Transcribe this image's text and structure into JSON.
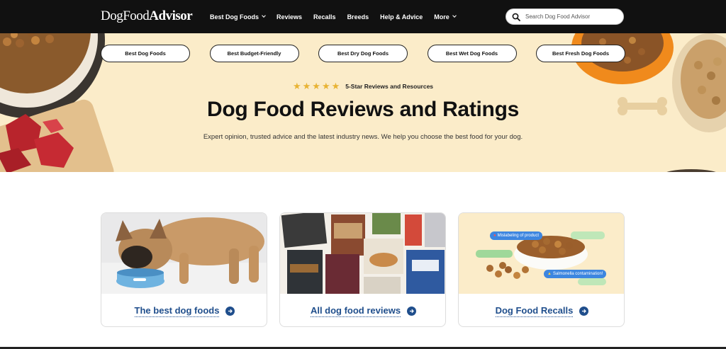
{
  "brand": {
    "logo_regular": "DogFood",
    "logo_bold": "Advisor"
  },
  "nav": [
    {
      "label": "Best Dog Foods",
      "has_dropdown": true
    },
    {
      "label": "Reviews",
      "has_dropdown": false
    },
    {
      "label": "Recalls",
      "has_dropdown": false
    },
    {
      "label": "Breeds",
      "has_dropdown": false
    },
    {
      "label": "Help & Advice",
      "has_dropdown": false
    },
    {
      "label": "More",
      "has_dropdown": true
    }
  ],
  "search": {
    "placeholder": "Search Dog Food Advisor",
    "value": ""
  },
  "hero": {
    "pills": [
      "Best Dog Foods",
      "Best Budget-Friendly",
      "Best Dry Dog Foods",
      "Best Wet Dog Foods",
      "Best Fresh Dog Foods"
    ],
    "rating_stars": 5,
    "rating_text": "5-Star Reviews and Resources",
    "title": "Dog Food Reviews and Ratings",
    "subtitle": "Expert opinion, trusted advice and the latest industry news. We help you choose the best food for your dog."
  },
  "cards": [
    {
      "label": "The best dog foods",
      "image": "dog-eating-from-bowl"
    },
    {
      "label": "All dog food reviews",
      "image": "dog-food-packages-collage"
    },
    {
      "label": "Dog Food Recalls",
      "image": "recall-alert-food-bowl",
      "bubbles": [
        "Mislabeling of product",
        "Salmonella contamination!"
      ]
    }
  ],
  "colors": {
    "header_bg": "#111111",
    "hero_bg": "#fbecc9",
    "link_blue": "#1f4e8c",
    "star_gold": "#e8b333"
  }
}
